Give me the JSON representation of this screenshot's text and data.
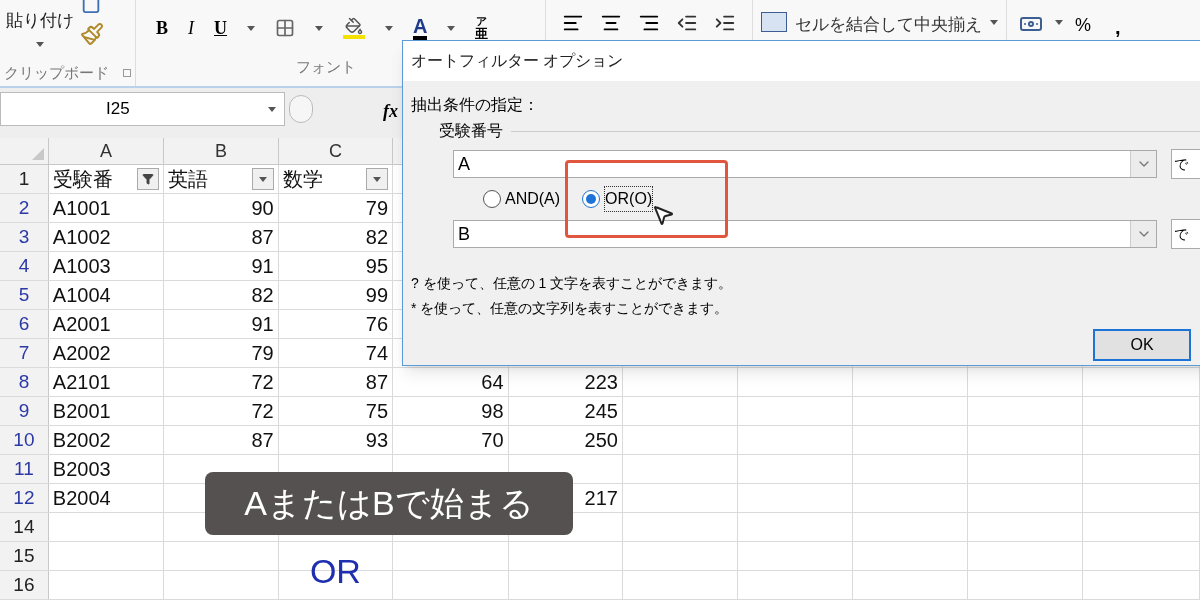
{
  "ribbon": {
    "paste_label": "貼り付け",
    "clipboard_label": "クリップボード",
    "font_label": "フォント",
    "bold": "B",
    "italic": "I",
    "underline": "U",
    "font_color": "A",
    "phonetic_top": "ア",
    "phonetic_bottom": "亜",
    "merge_label": "セルを結合して中央揃え",
    "percent": "%",
    "comma": ","
  },
  "formula_bar": {
    "name_box": "I25",
    "fx": "fx"
  },
  "sheet": {
    "columns": [
      "A",
      "B",
      "C"
    ],
    "filter_buttons": [
      {
        "filtered": true
      },
      {
        "filtered": false
      },
      {
        "filtered": false
      }
    ],
    "rows": [
      {
        "number": "1",
        "kind": "header",
        "filtered": false,
        "cells": [
          "受験番",
          "英語",
          "数学"
        ]
      },
      {
        "number": "2",
        "kind": "data",
        "filtered": true,
        "cells": [
          "A1001",
          "90",
          "79"
        ]
      },
      {
        "number": "3",
        "kind": "data",
        "filtered": true,
        "cells": [
          "A1002",
          "87",
          "82"
        ]
      },
      {
        "number": "4",
        "kind": "data",
        "filtered": true,
        "cells": [
          "A1003",
          "91",
          "95"
        ]
      },
      {
        "number": "5",
        "kind": "data",
        "filtered": true,
        "cells": [
          "A1004",
          "82",
          "99"
        ]
      },
      {
        "number": "6",
        "kind": "data",
        "filtered": true,
        "cells": [
          "A2001",
          "91",
          "76"
        ]
      },
      {
        "number": "7",
        "kind": "data",
        "filtered": true,
        "cells": [
          "A2002",
          "79",
          "74"
        ]
      },
      {
        "number": "8",
        "kind": "data",
        "filtered": true,
        "cells": [
          "A2101",
          "72",
          "87",
          "64",
          "223"
        ]
      },
      {
        "number": "9",
        "kind": "data",
        "filtered": true,
        "cells": [
          "B2001",
          "72",
          "75",
          "98",
          "245"
        ]
      },
      {
        "number": "10",
        "kind": "data",
        "filtered": true,
        "cells": [
          "B2002",
          "87",
          "93",
          "70",
          "250"
        ]
      },
      {
        "number": "11",
        "kind": "data",
        "filtered": true,
        "cells": [
          "B2003"
        ]
      },
      {
        "number": "12",
        "kind": "data",
        "filtered": true,
        "cells": [
          "B2004",
          null,
          null,
          null,
          "217"
        ]
      },
      {
        "number": "14",
        "kind": "data",
        "filtered": false,
        "cells": []
      },
      {
        "number": "15",
        "kind": "note",
        "filtered": false,
        "cells": [
          null,
          null,
          "OR"
        ]
      },
      {
        "number": "16",
        "kind": "data",
        "filtered": false,
        "cells": []
      }
    ]
  },
  "dialog": {
    "title": "オートフィルター オプション",
    "prompt": "抽出条件の指定：",
    "field_label": "受験番号",
    "condition_1": {
      "value": "A",
      "operator": "で"
    },
    "logic": [
      {
        "label": "AND(A)",
        "selected": false
      },
      {
        "label": "OR(O)",
        "selected": true
      }
    ],
    "condition_2": {
      "value": "B",
      "operator": "で"
    },
    "hints": [
      "? を使って、任意の 1 文字を表すことができます。",
      "* を使って、任意の文字列を表すことができます。"
    ],
    "ok_button": "OK"
  },
  "subtitle": "AまたはBで始まる"
}
